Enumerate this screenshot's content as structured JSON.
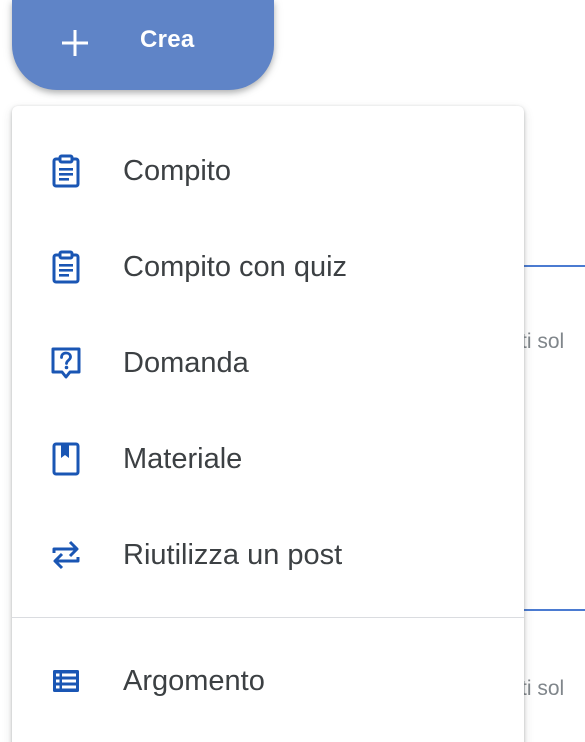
{
  "create_button": {
    "label": "Crea",
    "icon": "plus-icon"
  },
  "menu": {
    "items": [
      {
        "label": "Compito",
        "icon": "assignment-icon"
      },
      {
        "label": "Compito con quiz",
        "icon": "quiz-assignment-icon"
      },
      {
        "label": "Domanda",
        "icon": "question-icon"
      },
      {
        "label": "Materiale",
        "icon": "material-icon"
      },
      {
        "label": "Riutilizza un post",
        "icon": "reuse-post-icon"
      }
    ],
    "topic": {
      "label": "Argomento",
      "icon": "topic-icon"
    }
  },
  "background": {
    "snippet_1": "ti sol",
    "snippet_2": "ti sol"
  },
  "colors": {
    "accent": "#1a56b4",
    "button": "#5f84c7",
    "text": "#3c4043"
  }
}
